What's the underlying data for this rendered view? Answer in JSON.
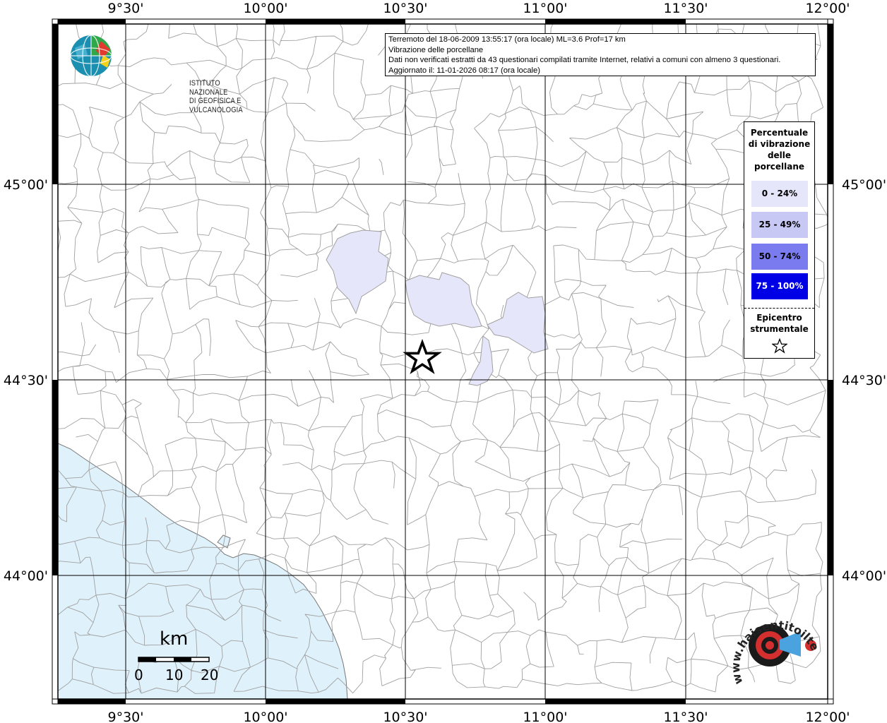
{
  "header_info": {
    "line1": "Terremoto del 18-06-2009 13:55:17 (ora locale) ML=3.6 Prof=17 km",
    "line2": "Vibrazione delle porcellane",
    "line3": "Dati non verificati estratti da 43 questionari compilati tramite Internet, relativi a comuni con almeno 3 questionari.",
    "line4": "Aggiornato il: 11-01-2026 08:17 (ora locale)"
  },
  "institute_logo": {
    "line1": "ISTITUTO NAZIONALE",
    "line2": "DI GEOFISICA E VULCANOLOGIA"
  },
  "axes": {
    "lon_ticks": [
      "9°30'",
      "10°00'",
      "10°30'",
      "11°00'",
      "11°30'",
      "12°00'"
    ],
    "lat_ticks": [
      "45°00'",
      "44°30'",
      "44°00'"
    ]
  },
  "legend": {
    "title_lines": [
      "Percentuale",
      "di vibrazione",
      "delle",
      "porcellane"
    ],
    "classes": [
      {
        "label": "0 - 24%",
        "color": "#e6e6fa"
      },
      {
        "label": "25 - 49%",
        "color": "#c8c8f5"
      },
      {
        "label": "50 - 74%",
        "color": "#7b7bf0"
      },
      {
        "label": "75 - 100%",
        "color": "#0000e6"
      }
    ],
    "epicenter_lines": [
      "Epicentro",
      "strumentale"
    ]
  },
  "scale": {
    "unit": "km",
    "labels": [
      "0",
      "10",
      "20"
    ]
  },
  "colors": {
    "sea": "#dff1fb",
    "municipality_fill_low": "#e6e6fa",
    "border_gray": "#9a9a9a",
    "graticule": "#000000"
  },
  "watermark": {
    "text": "www.haisentitoilterremoto.it"
  }
}
